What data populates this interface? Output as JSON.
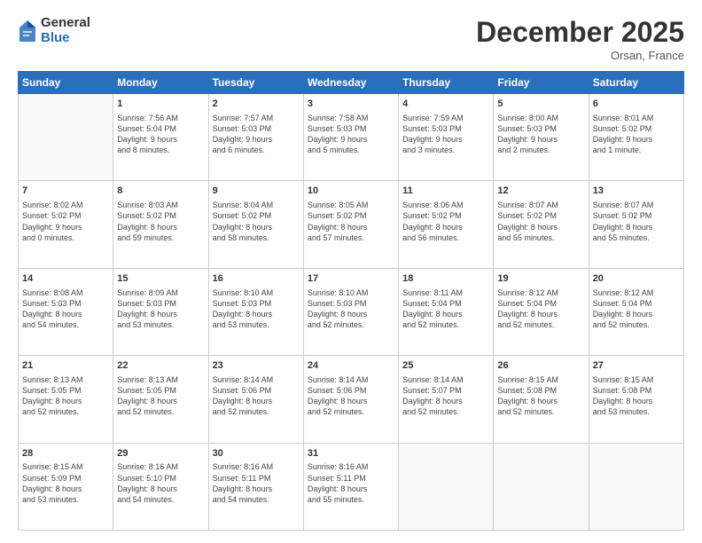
{
  "header": {
    "logo_general": "General",
    "logo_blue": "Blue",
    "month_title": "December 2025",
    "location": "Orsan, France"
  },
  "weekdays": [
    "Sunday",
    "Monday",
    "Tuesday",
    "Wednesday",
    "Thursday",
    "Friday",
    "Saturday"
  ],
  "weeks": [
    [
      {
        "day": "",
        "info": ""
      },
      {
        "day": "1",
        "info": "Sunrise: 7:56 AM\nSunset: 5:04 PM\nDaylight: 9 hours\nand 8 minutes."
      },
      {
        "day": "2",
        "info": "Sunrise: 7:57 AM\nSunset: 5:03 PM\nDaylight: 9 hours\nand 6 minutes."
      },
      {
        "day": "3",
        "info": "Sunrise: 7:58 AM\nSunset: 5:03 PM\nDaylight: 9 hours\nand 5 minutes."
      },
      {
        "day": "4",
        "info": "Sunrise: 7:59 AM\nSunset: 5:03 PM\nDaylight: 9 hours\nand 3 minutes."
      },
      {
        "day": "5",
        "info": "Sunrise: 8:00 AM\nSunset: 5:03 PM\nDaylight: 9 hours\nand 2 minutes."
      },
      {
        "day": "6",
        "info": "Sunrise: 8:01 AM\nSunset: 5:02 PM\nDaylight: 9 hours\nand 1 minute."
      }
    ],
    [
      {
        "day": "7",
        "info": "Sunrise: 8:02 AM\nSunset: 5:02 PM\nDaylight: 9 hours\nand 0 minutes."
      },
      {
        "day": "8",
        "info": "Sunrise: 8:03 AM\nSunset: 5:02 PM\nDaylight: 8 hours\nand 59 minutes."
      },
      {
        "day": "9",
        "info": "Sunrise: 8:04 AM\nSunset: 5:02 PM\nDaylight: 8 hours\nand 58 minutes."
      },
      {
        "day": "10",
        "info": "Sunrise: 8:05 AM\nSunset: 5:02 PM\nDaylight: 8 hours\nand 57 minutes."
      },
      {
        "day": "11",
        "info": "Sunrise: 8:06 AM\nSunset: 5:02 PM\nDaylight: 8 hours\nand 56 minutes."
      },
      {
        "day": "12",
        "info": "Sunrise: 8:07 AM\nSunset: 5:02 PM\nDaylight: 8 hours\nand 55 minutes."
      },
      {
        "day": "13",
        "info": "Sunrise: 8:07 AM\nSunset: 5:02 PM\nDaylight: 8 hours\nand 55 minutes."
      }
    ],
    [
      {
        "day": "14",
        "info": "Sunrise: 8:08 AM\nSunset: 5:03 PM\nDaylight: 8 hours\nand 54 minutes."
      },
      {
        "day": "15",
        "info": "Sunrise: 8:09 AM\nSunset: 5:03 PM\nDaylight: 8 hours\nand 53 minutes."
      },
      {
        "day": "16",
        "info": "Sunrise: 8:10 AM\nSunset: 5:03 PM\nDaylight: 8 hours\nand 53 minutes."
      },
      {
        "day": "17",
        "info": "Sunrise: 8:10 AM\nSunset: 5:03 PM\nDaylight: 8 hours\nand 52 minutes."
      },
      {
        "day": "18",
        "info": "Sunrise: 8:11 AM\nSunset: 5:04 PM\nDaylight: 8 hours\nand 52 minutes."
      },
      {
        "day": "19",
        "info": "Sunrise: 8:12 AM\nSunset: 5:04 PM\nDaylight: 8 hours\nand 52 minutes."
      },
      {
        "day": "20",
        "info": "Sunrise: 8:12 AM\nSunset: 5:04 PM\nDaylight: 8 hours\nand 52 minutes."
      }
    ],
    [
      {
        "day": "21",
        "info": "Sunrise: 8:13 AM\nSunset: 5:05 PM\nDaylight: 8 hours\nand 52 minutes."
      },
      {
        "day": "22",
        "info": "Sunrise: 8:13 AM\nSunset: 5:05 PM\nDaylight: 8 hours\nand 52 minutes."
      },
      {
        "day": "23",
        "info": "Sunrise: 8:14 AM\nSunset: 5:06 PM\nDaylight: 8 hours\nand 52 minutes."
      },
      {
        "day": "24",
        "info": "Sunrise: 8:14 AM\nSunset: 5:06 PM\nDaylight: 8 hours\nand 52 minutes."
      },
      {
        "day": "25",
        "info": "Sunrise: 8:14 AM\nSunset: 5:07 PM\nDaylight: 8 hours\nand 52 minutes."
      },
      {
        "day": "26",
        "info": "Sunrise: 8:15 AM\nSunset: 5:08 PM\nDaylight: 8 hours\nand 52 minutes."
      },
      {
        "day": "27",
        "info": "Sunrise: 8:15 AM\nSunset: 5:08 PM\nDaylight: 8 hours\nand 53 minutes."
      }
    ],
    [
      {
        "day": "28",
        "info": "Sunrise: 8:15 AM\nSunset: 5:09 PM\nDaylight: 8 hours\nand 53 minutes."
      },
      {
        "day": "29",
        "info": "Sunrise: 8:16 AM\nSunset: 5:10 PM\nDaylight: 8 hours\nand 54 minutes."
      },
      {
        "day": "30",
        "info": "Sunrise: 8:16 AM\nSunset: 5:11 PM\nDaylight: 8 hours\nand 54 minutes."
      },
      {
        "day": "31",
        "info": "Sunrise: 8:16 AM\nSunset: 5:11 PM\nDaylight: 8 hours\nand 55 minutes."
      },
      {
        "day": "",
        "info": ""
      },
      {
        "day": "",
        "info": ""
      },
      {
        "day": "",
        "info": ""
      }
    ]
  ]
}
